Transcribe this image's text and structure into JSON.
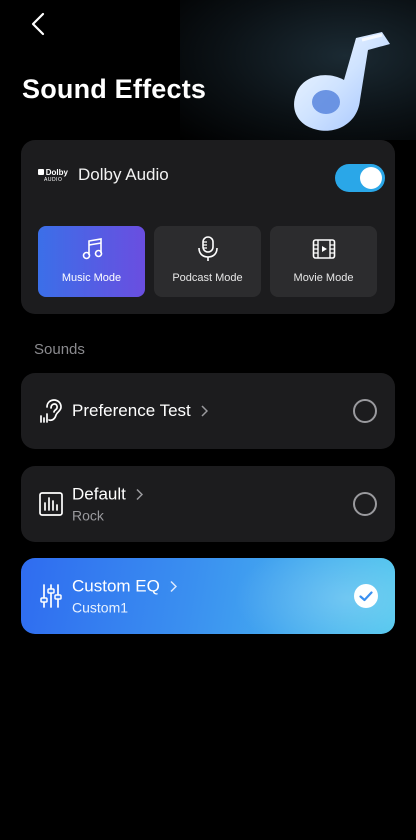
{
  "header": {
    "title": "Sound Effects"
  },
  "dolby": {
    "logo_line1": "Dolby",
    "logo_line2": "AUDIO",
    "label": "Dolby Audio",
    "enabled": true,
    "accent_color": "#2aa7e8"
  },
  "modes": [
    {
      "label": "Music Mode",
      "icon": "music-note-icon",
      "selected": true
    },
    {
      "label": "Podcast Mode",
      "icon": "microphone-icon",
      "selected": false
    },
    {
      "label": "Movie Mode",
      "icon": "film-icon",
      "selected": false
    }
  ],
  "sounds": {
    "section_label": "Sounds",
    "options": [
      {
        "name": "Preference Test",
        "sub": "",
        "icon": "ear-icon",
        "selected": false
      },
      {
        "name": "Default",
        "sub": "Rock",
        "icon": "equalizer-bars-icon",
        "selected": false
      },
      {
        "name": "Custom EQ",
        "sub": "Custom1",
        "icon": "sliders-icon",
        "selected": true
      }
    ]
  }
}
